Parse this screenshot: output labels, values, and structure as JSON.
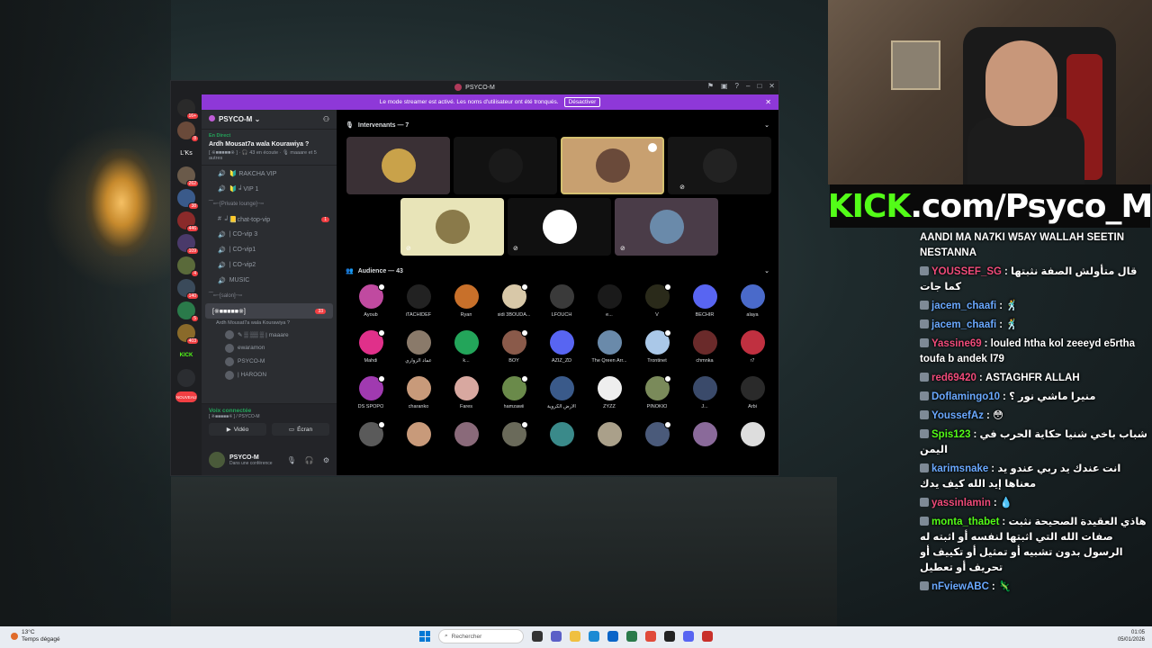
{
  "window": {
    "title": "PSYCO-M"
  },
  "banner": {
    "text": "Le mode streamer est activé. Les noms d'utilisateur ont été tronqués.",
    "button": "Désactiver"
  },
  "rail": {
    "servers": [
      {
        "label": "",
        "badge": "16+"
      },
      {
        "label": "",
        "badge": "8"
      },
      {
        "label": "L'Ks",
        "badge": ""
      },
      {
        "label": "",
        "badge": "262"
      },
      {
        "label": "",
        "badge": "38"
      },
      {
        "label": "",
        "badge": "446"
      },
      {
        "label": "",
        "badge": "109"
      },
      {
        "label": "",
        "badge": "4"
      },
      {
        "label": "",
        "badge": "140"
      },
      {
        "label": "",
        "badge": "5"
      },
      {
        "label": "",
        "badge": "403"
      },
      {
        "label": "KICK",
        "badge": ""
      },
      {
        "label": "",
        "badge": ""
      },
      {
        "label": "NOUVEAU",
        "badge": ""
      }
    ]
  },
  "server": {
    "name": "PSYCO-M"
  },
  "event": {
    "live": "En Direct",
    "title": "Ardh Mousat7a wala Kourawiya ?",
    "meta": "[ ※■■■■■※ ]  · 🎧 43 en écoute · 🎙 maaare et 5 autres"
  },
  "channels": [
    {
      "type": "voice",
      "label": "🔰 RAKCHA VIP"
    },
    {
      "type": "voice",
      "label": "🔰 ╛VIP 1"
    },
    {
      "type": "cat",
      "label": "⁀┅╌[Private lounge]╌┅"
    },
    {
      "type": "text",
      "label": "╛📒chat-top-vip",
      "count": "1"
    },
    {
      "type": "voice",
      "label": "| CO-vip 3"
    },
    {
      "type": "voice",
      "label": "| CO-vip1"
    },
    {
      "type": "voice",
      "label": "| CO-vip2"
    },
    {
      "type": "voice",
      "label": "MUSIC"
    },
    {
      "type": "cat",
      "label": "⁀┅╌[salon]╌┅"
    }
  ],
  "active_channel": {
    "label": "[※■■■■■※]",
    "sub": "Ardh Mousat7a wala Kourawiya ?",
    "count": "33"
  },
  "voice_members": [
    "✎ ▒ ▒▒ ▒ | maaare",
    "ewaramon",
    "PSYCO-M",
    "| HAROON"
  ],
  "voice_panel": {
    "status": "Voix connectée",
    "sub": "[ ※■■■■■※ ] / PSYCO-M",
    "video": "Vidéo",
    "screen": "Écran"
  },
  "user": {
    "name": "PSYCO-M",
    "status": "Dans une conférence"
  },
  "stage": {
    "speakers_title": "Intervenants — 7",
    "audience_title": "Audience — 43"
  },
  "audience": [
    "Ayoub",
    "iTACHIDEF",
    "Ryan",
    "sidi 3BOUDA...",
    "LFOUCH",
    "e...",
    "V",
    "BECHIR",
    "alaya",
    "Mahdi",
    "عماد الزواري",
    "k...",
    "BOY",
    "AZIZ_ZD",
    "The Qreen Arr...",
    "Trontinet",
    "chmnka",
    "r7",
    "DS SPOPO",
    "charanko",
    "Fares",
    "hamzawii",
    "الأرض الكروية",
    "ZYZZ",
    "PINOKIO",
    "J...",
    "Arbi",
    "",
    "",
    "",
    "",
    "",
    "",
    "",
    "",
    ""
  ],
  "kick_banner": {
    "k": "KICK",
    "rest": ".com/Psyco_M"
  },
  "chat": [
    {
      "user": "",
      "text": "AANDI MA NA7KI W5AY WALLAH SEETIN NESTANNA",
      "color": "#ffffff"
    },
    {
      "user": "YOUSSEF_SG",
      "text": "قال متأولش الصفة نثبتها كما جات",
      "color": "#f04b7a"
    },
    {
      "user": "jacem_chaafi",
      "text": "🕺",
      "color": "#6aa9ff"
    },
    {
      "user": "jacem_chaafi",
      "text": "🕺",
      "color": "#6aa9ff"
    },
    {
      "user": "Yassine69",
      "text": "louled htha kol zeeeyd e5rtha toufa b andek l79",
      "color": "#f04b7a"
    },
    {
      "user": "red69420",
      "text": "ASTAGHFR ALLAH",
      "color": "#f04b7a"
    },
    {
      "user": "Doflamingo10",
      "text": "منيرا ماشي نور ؟",
      "color": "#6aa9ff"
    },
    {
      "user": "YoussefAz",
      "text": "😳",
      "color": "#6aa9ff"
    },
    {
      "user": "Spis123",
      "text": "شباب باخي شنيا حكاية الحرب في اليمن",
      "color": "#53fc18"
    },
    {
      "user": "karimsnake",
      "text": "انت عندك يد ربي عندو يد معناها إيد الله كيف يدك",
      "color": "#6aa9ff"
    },
    {
      "user": "yassinlamin",
      "text": "💧",
      "color": "#f04b7a"
    },
    {
      "user": "monta_thabet",
      "text": "هاذي العقيدة الصحيحة نثبت صفات الله التي اثبتها لنفسه أو اثبته له الرسول بدون تشبيه أو تمثيل أو تكييف أو تحريف أو تعطيل",
      "color": "#53fc18"
    },
    {
      "user": "nFviewABC",
      "text": "🦎",
      "color": "#6aa9ff"
    }
  ],
  "taskbar": {
    "temp": "13°C",
    "weather": "Temps dégagé",
    "search": "Rechercher",
    "time": "01:05",
    "date": "05/01/2026"
  }
}
